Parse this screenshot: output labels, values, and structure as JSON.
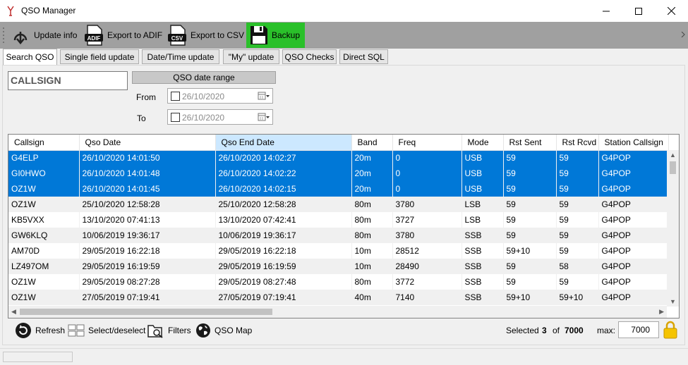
{
  "window": {
    "title": "QSO Manager"
  },
  "toolbar": {
    "update_info": "Update info",
    "export_adif": "Export to ADIF",
    "adif_badge": "ADIF",
    "export_csv": "Export to CSV",
    "csv_badge": "CSV",
    "backup": "Backup",
    "backup_color": "#2ac02a"
  },
  "tabs": [
    "Search QSO",
    "Single field update",
    "Date/Time update",
    "\"My\" update",
    "QSO Checks",
    "Direct SQL"
  ],
  "search": {
    "callsign_value": "CALLSIGN",
    "date_range_label": "QSO date range",
    "from_label": "From",
    "to_label": "To",
    "from_date": "26/10/2020",
    "to_date": "26/10/2020"
  },
  "grid": {
    "columns": [
      "Callsign",
      "Qso Date",
      "Qso End Date",
      "Band",
      "Freq",
      "Mode",
      "Rst Sent",
      "Rst Rcvd",
      "Station Callsign"
    ],
    "sorted_column": "Qso End Date",
    "selection_color": "#0078d7",
    "rows": [
      [
        "G4ELP",
        "26/10/2020 14:01:50",
        "26/10/2020 14:02:27",
        "20m",
        "0",
        "USB",
        "59",
        "59",
        "G4POP"
      ],
      [
        "GI0HWO",
        "26/10/2020 14:01:48",
        "26/10/2020 14:02:22",
        "20m",
        "0",
        "USB",
        "59",
        "59",
        "G4POP"
      ],
      [
        "OZ1W",
        "26/10/2020 14:01:45",
        "26/10/2020 14:02:15",
        "20m",
        "0",
        "USB",
        "59",
        "59",
        "G4POP"
      ],
      [
        "OZ1W",
        "25/10/2020 12:58:28",
        "25/10/2020 12:58:28",
        "80m",
        "3780",
        "LSB",
        "59",
        "59",
        "G4POP"
      ],
      [
        "KB5VXX",
        "13/10/2020 07:41:13",
        "13/10/2020 07:42:41",
        "80m",
        "3727",
        "LSB",
        "59",
        "59",
        "G4POP"
      ],
      [
        "GW6KLQ",
        "10/06/2019 19:36:17",
        "10/06/2019 19:36:17",
        "80m",
        "3780",
        "SSB",
        "59",
        "59",
        "G4POP"
      ],
      [
        "AM70D",
        "29/05/2019 16:22:18",
        "29/05/2019 16:22:18",
        "10m",
        "28512",
        "SSB",
        "59+10",
        "59",
        "G4POP"
      ],
      [
        "LZ497OM",
        "29/05/2019 16:19:59",
        "29/05/2019 16:19:59",
        "10m",
        "28490",
        "SSB",
        "59",
        "58",
        "G4POP"
      ],
      [
        "OZ1W",
        "29/05/2019 08:27:28",
        "29/05/2019 08:27:48",
        "80m",
        "3772",
        "SSB",
        "59",
        "59",
        "G4POP"
      ],
      [
        "OZ1W",
        "27/05/2019 07:19:41",
        "27/05/2019 07:19:41",
        "40m",
        "7140",
        "SSB",
        "59+10",
        "59+10",
        "G4POP"
      ]
    ],
    "selected_rows": 3
  },
  "bottom": {
    "refresh": "Refresh",
    "select_deselect": "Select/deselect",
    "filters": "Filters",
    "qso_map": "QSO Map",
    "selected_label": "Selected",
    "selected_count": "3",
    "of_label": "of",
    "total_count": "7000",
    "max_label": "max:",
    "max_value": "7000"
  },
  "icons": {
    "app": "antenna-icon",
    "update": "download-icon",
    "adif": "adif-file-icon",
    "csv": "csv-file-icon",
    "backup": "floppy-disk-icon",
    "refresh": "refresh-icon",
    "select": "grid-select-icon",
    "filters": "filter-folder-icon",
    "map": "globe-icon",
    "lock": "lock-icon"
  }
}
